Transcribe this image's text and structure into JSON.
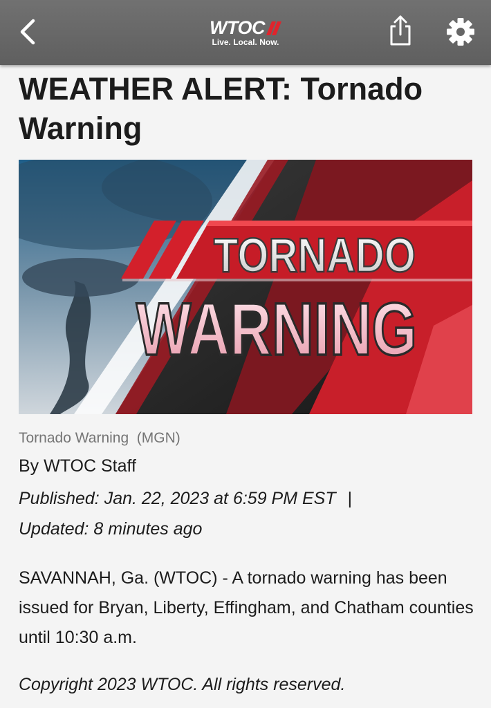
{
  "header": {
    "logo_text": "WTOC",
    "logo_tagline": "Live. Local. Now.",
    "back_icon": "chevron-left-icon",
    "share_icon": "share-icon",
    "settings_icon": "gear-icon",
    "bar_color": "#666666"
  },
  "article": {
    "headline": "WEATHER ALERT: Tornado Warning",
    "hero_image": {
      "line1": "TORNADO",
      "line2": "WARNING",
      "accent_color": "#d3202b"
    },
    "caption": "Tornado Warning  (MGN)",
    "byline": "By WTOC Staff",
    "published": "Published: Jan. 22, 2023 at 6:59 PM EST",
    "separator": "|",
    "updated": "Updated: 8 minutes ago",
    "body": "SAVANNAH, Ga. (WTOC) - A tornado warning has been issued for Bryan, Liberty, Effingham, and Chatham counties until 10:30 a.m.",
    "copyright": "Copyright 2023 WTOC. All rights reserved."
  }
}
